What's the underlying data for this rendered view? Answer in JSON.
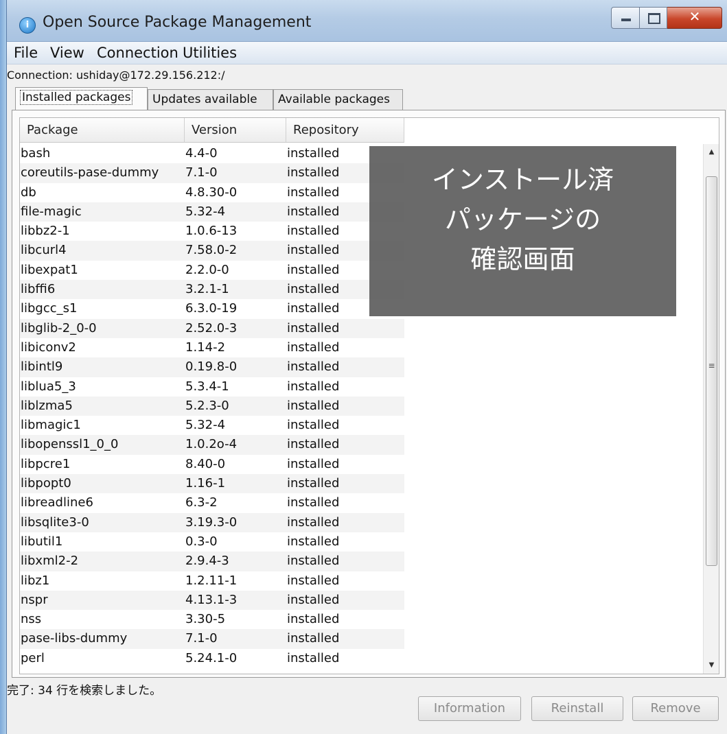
{
  "window": {
    "title": "Open Source Package Management"
  },
  "menu": [
    "File",
    "View",
    "Connection",
    "Utilities"
  ],
  "connection_label": "Connection: ushiday@172.29.156.212:/",
  "tabs": [
    "Installed packages",
    "Updates available",
    "Available packages"
  ],
  "table": {
    "columns": [
      "Package",
      "Version",
      "Repository"
    ],
    "rows": [
      [
        "bash",
        "4.4-0",
        "installed"
      ],
      [
        "coreutils-pase-dummy",
        "7.1-0",
        "installed"
      ],
      [
        "db",
        "4.8.30-0",
        "installed"
      ],
      [
        "file-magic",
        "5.32-4",
        "installed"
      ],
      [
        "libbz2-1",
        "1.0.6-13",
        "installed"
      ],
      [
        "libcurl4",
        "7.58.0-2",
        "installed"
      ],
      [
        "libexpat1",
        "2.2.0-0",
        "installed"
      ],
      [
        "libffi6",
        "3.2.1-1",
        "installed"
      ],
      [
        "libgcc_s1",
        "6.3.0-19",
        "installed"
      ],
      [
        "libglib-2_0-0",
        "2.52.0-3",
        "installed"
      ],
      [
        "libiconv2",
        "1.14-2",
        "installed"
      ],
      [
        "libintl9",
        "0.19.8-0",
        "installed"
      ],
      [
        "liblua5_3",
        "5.3.4-1",
        "installed"
      ],
      [
        "liblzma5",
        "5.2.3-0",
        "installed"
      ],
      [
        "libmagic1",
        "5.32-4",
        "installed"
      ],
      [
        "libopenssl1_0_0",
        "1.0.2o-4",
        "installed"
      ],
      [
        "libpcre1",
        "8.40-0",
        "installed"
      ],
      [
        "libpopt0",
        "1.16-1",
        "installed"
      ],
      [
        "libreadline6",
        "6.3-2",
        "installed"
      ],
      [
        "libsqlite3-0",
        "3.19.3-0",
        "installed"
      ],
      [
        "libutil1",
        "0.3-0",
        "installed"
      ],
      [
        "libxml2-2",
        "2.9.4-3",
        "installed"
      ],
      [
        "libz1",
        "1.2.11-1",
        "installed"
      ],
      [
        "nspr",
        "4.13.1-3",
        "installed"
      ],
      [
        "nss",
        "3.30-5",
        "installed"
      ],
      [
        "pase-libs-dummy",
        "7.1-0",
        "installed"
      ],
      [
        "perl",
        "5.24.1-0",
        "installed"
      ]
    ]
  },
  "overlay": [
    "インストール済",
    "パッケージの",
    "確認画面"
  ],
  "status": "完了: 34 行を検索しました。",
  "buttons": [
    "Information",
    "Reinstall",
    "Remove"
  ],
  "icons": {
    "app": "app-globe-icon",
    "minimize": "minimize-icon",
    "maximize": "maximize-icon",
    "close": "close-icon"
  },
  "colors": {
    "titlebar": "#b4cbe5",
    "close_button": "#c9472b",
    "overlay": "#555555"
  }
}
